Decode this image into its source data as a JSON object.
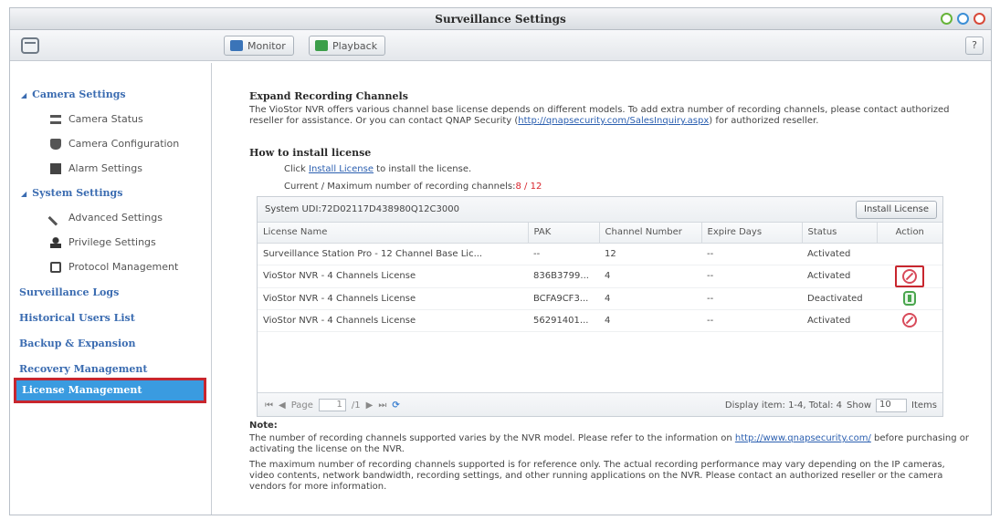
{
  "window": {
    "title": "Surveillance Settings",
    "help": "?"
  },
  "toolbar": {
    "monitor": "Monitor",
    "playback": "Playback"
  },
  "sidebar": {
    "camera_settings": "Camera Settings",
    "camera_status": "Camera Status",
    "camera_configuration": "Camera Configuration",
    "alarm_settings": "Alarm Settings",
    "system_settings": "System Settings",
    "advanced_settings": "Advanced Settings",
    "privilege_settings": "Privilege Settings",
    "protocol_management": "Protocol Management",
    "surveillance_logs": "Surveillance Logs",
    "historical_users": "Historical Users List",
    "backup_expansion": "Backup & Expansion",
    "recovery_management": "Recovery Management",
    "license_management": "License Management"
  },
  "main": {
    "heading": "Expand Recording Channels",
    "desc_a": "The VioStor NVR offers various channel base license depends on different models. To add extra number of recording channels, please contact authorized reseller for assistance. Or you can contact QNAP Security (",
    "desc_link": "http://qnapsecurity.com/SalesInquiry.aspx",
    "desc_b": ") for authorized reseller.",
    "howto": "How to install license",
    "click_a": "Click ",
    "click_link": "Install License",
    "click_b": " to install the license.",
    "current_label": "Current / Maximum number of recording channels:",
    "current_value": "8 / 12",
    "system_udi": "System UDI:72D02117D438980Q12C3000",
    "install_button": "Install License",
    "columns": [
      "License Name",
      "PAK",
      "Channel Number",
      "Expire Days",
      "Status",
      "Action"
    ],
    "rows": [
      {
        "name": "Surveillance Station Pro - 12 Channel Base Lic...",
        "pak": "--",
        "channels": "12",
        "expire": "--",
        "status": "Activated"
      },
      {
        "name": "VioStor NVR - 4 Channels License",
        "pak": "836B3799...",
        "channels": "4",
        "expire": "--",
        "status": "Activated"
      },
      {
        "name": "VioStor NVR - 4 Channels License",
        "pak": "BCFA9CF3...",
        "channels": "4",
        "expire": "--",
        "status": "Deactivated"
      },
      {
        "name": "VioStor NVR - 4 Channels License",
        "pak": "56291401...",
        "channels": "4",
        "expire": "--",
        "status": "Activated"
      }
    ],
    "pager": {
      "page_label": "Page",
      "page_value": "1",
      "page_total": "/1",
      "display": "Display item: 1-4, Total: 4",
      "show_label": "Show",
      "show_value": "10",
      "items_label": "Items"
    },
    "note_heading": "Note:",
    "note1_a": "The number of recording channels supported varies by the NVR model. Please refer to the information on ",
    "note1_link": "http://www.qnapsecurity.com/",
    "note1_b": " before purchasing or activating the license on the NVR.",
    "note2": "The maximum number of recording channels supported is for reference only. The actual recording performance may vary depending on the IP cameras, video contents, network bandwidth, recording settings, and other running applications on the NVR. Please contact an authorized reseller or the camera vendors for more information."
  }
}
